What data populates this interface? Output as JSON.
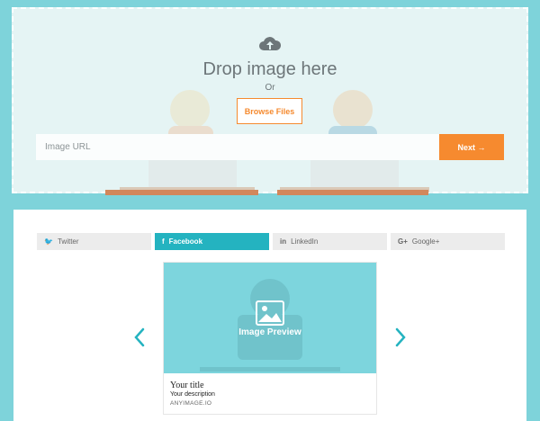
{
  "upload": {
    "title": "Drop image here",
    "or_text": "Or",
    "browse_label": "Browse Files",
    "url_placeholder": "Image URL",
    "next_label": "Next →"
  },
  "tabs": [
    {
      "icon": "twitter-icon",
      "glyph": "🐦",
      "label": "Twitter",
      "active": false
    },
    {
      "icon": "facebook-icon",
      "glyph": "f",
      "label": "Facebook",
      "active": true
    },
    {
      "icon": "linkedin-icon",
      "glyph": "in",
      "label": "LinkedIn",
      "active": false
    },
    {
      "icon": "google-plus-icon",
      "glyph": "G+",
      "label": "Google+",
      "active": false
    }
  ],
  "preview": {
    "image_label": "Image Preview",
    "title": "Your title",
    "description": "Your description",
    "domain": "ANYIMAGE.IO"
  },
  "colors": {
    "accent": "#f68a2f",
    "teal": "#7ed3da",
    "active_tab": "#24b3c0"
  }
}
